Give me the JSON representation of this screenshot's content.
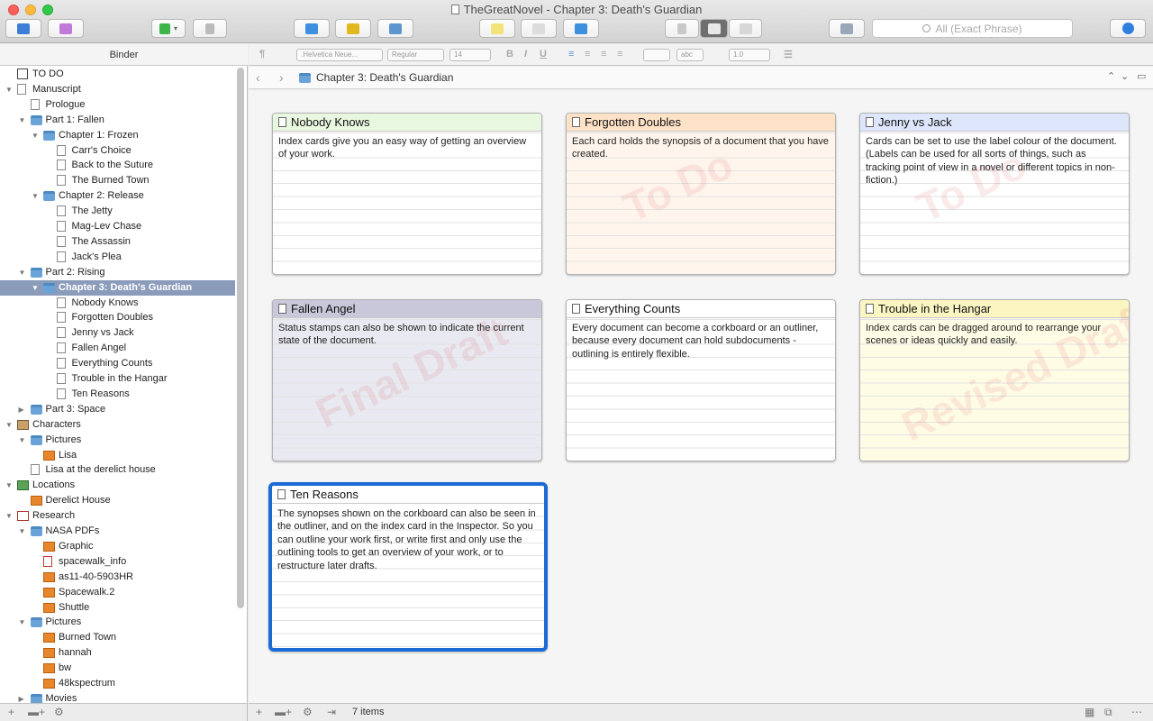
{
  "window": {
    "title": "TheGreatNovel - Chapter 3: Death's Guardian"
  },
  "search": {
    "placeholder": "All (Exact Phrase)"
  },
  "colors": {
    "selection": "#1a6bd6",
    "binder_selection": "#8b9cbb"
  },
  "format_bar": {
    "font": ".Helvetica Neue...",
    "style": "Regular",
    "size": "14",
    "line_spacing": "1.0",
    "paragraph_glyph": "¶",
    "abc": "abc"
  },
  "binder": {
    "header": "Binder",
    "items": [
      {
        "label": "TO DO",
        "icon": "checkbox-icon"
      },
      {
        "label": "Manuscript",
        "icon": "manuscript-icon"
      },
      {
        "label": "Prologue",
        "icon": "document-icon"
      },
      {
        "label": "Part 1: Fallen",
        "icon": "folder-icon"
      },
      {
        "label": "Chapter 1: Frozen",
        "icon": "folder-icon"
      },
      {
        "label": "Carr's Choice",
        "icon": "document-icon"
      },
      {
        "label": "Back to the Suture",
        "icon": "document-icon"
      },
      {
        "label": "The Burned Town",
        "icon": "document-icon"
      },
      {
        "label": "Chapter 2: Release",
        "icon": "folder-icon"
      },
      {
        "label": "The Jetty",
        "icon": "document-icon"
      },
      {
        "label": "Mag-Lev Chase",
        "icon": "document-icon"
      },
      {
        "label": "The Assassin",
        "icon": "document-icon"
      },
      {
        "label": "Jack's Plea",
        "icon": "document-icon"
      },
      {
        "label": "Part 2: Rising",
        "icon": "folder-icon"
      },
      {
        "label": "Chapter 3: Death's Guardian",
        "icon": "folder-icon"
      },
      {
        "label": "Nobody Knows",
        "icon": "document-icon"
      },
      {
        "label": "Forgotten Doubles",
        "icon": "document-icon"
      },
      {
        "label": "Jenny vs Jack",
        "icon": "document-icon"
      },
      {
        "label": "Fallen Angel",
        "icon": "document-icon"
      },
      {
        "label": "Everything Counts",
        "icon": "document-icon"
      },
      {
        "label": "Trouble in the Hangar",
        "icon": "document-icon"
      },
      {
        "label": "Ten Reasons",
        "icon": "document-icon"
      },
      {
        "label": "Part 3: Space",
        "icon": "folder-icon"
      },
      {
        "label": "Characters",
        "icon": "characters-icon"
      },
      {
        "label": "Pictures",
        "icon": "folder-icon"
      },
      {
        "label": "Lisa",
        "icon": "image-icon"
      },
      {
        "label": "Lisa at the derelict house",
        "icon": "document-icon"
      },
      {
        "label": "Locations",
        "icon": "locations-icon"
      },
      {
        "label": "Derelict House",
        "icon": "image-icon"
      },
      {
        "label": "Research",
        "icon": "research-icon"
      },
      {
        "label": "NASA PDFs",
        "icon": "folder-icon"
      },
      {
        "label": "Graphic",
        "icon": "image-icon"
      },
      {
        "label": "spacewalk_info",
        "icon": "pdf-icon"
      },
      {
        "label": "as11-40-5903HR",
        "icon": "image-icon"
      },
      {
        "label": "Spacewalk.2",
        "icon": "image-icon"
      },
      {
        "label": "Shuttle",
        "icon": "image-icon"
      },
      {
        "label": "Pictures",
        "icon": "folder-icon"
      },
      {
        "label": "Burned Town",
        "icon": "image-icon"
      },
      {
        "label": "hannah",
        "icon": "image-icon"
      },
      {
        "label": "bw",
        "icon": "image-icon"
      },
      {
        "label": "48kspectrum",
        "icon": "image-icon"
      },
      {
        "label": "Movies",
        "icon": "folder-icon"
      }
    ]
  },
  "pathbar": {
    "title": "Chapter 3: Death's Guardian"
  },
  "cards": [
    {
      "title": "Nobody Knows",
      "text": "Index cards give you an easy way of getting an overview of your work.",
      "header_color": "#e8f7df",
      "body_color": "#ffffff",
      "stamp": ""
    },
    {
      "title": "Forgotten Doubles",
      "text": "Each card holds the synopsis of a document that you have created.",
      "header_color": "#fde2c8",
      "body_color": "#fff5ec",
      "stamp": "To Do"
    },
    {
      "title": "Jenny vs Jack",
      "text": "Cards can be set to use the label colour of the document. (Labels can be used for all sorts of things, such as tracking point of view in a novel or different topics in non-fiction.)",
      "header_color": "#dde6fb",
      "body_color": "#ffffff",
      "stamp": "To Do"
    },
    {
      "title": "Fallen Angel",
      "text": "Status stamps can also be shown to indicate the current state of the document.",
      "header_color": "#c8c8da",
      "body_color": "#e9e9f1",
      "stamp": "Final Draft"
    },
    {
      "title": "Everything Counts",
      "text": "Every document can become a corkboard or an outliner, because every document can hold subdocuments - outlining is entirely flexible.",
      "header_color": "#ffffff",
      "body_color": "#ffffff",
      "stamp": ""
    },
    {
      "title": "Trouble in the Hangar",
      "text": "Index cards can be dragged around to rearrange your scenes or ideas quickly and easily.",
      "header_color": "#fbf5c2",
      "body_color": "#fffce6",
      "stamp": "Revised Draft"
    },
    {
      "title": "Ten Reasons",
      "text": "The synopses shown on the corkboard can also be seen in the outliner, and on the index card in the Inspector. So you can outline your work first, or write first and only use the outlining tools to get an overview of your work, or to restructure later drafts.",
      "header_color": "#ffffff",
      "body_color": "#ffffff",
      "stamp": ""
    }
  ],
  "footer": {
    "item_count": "7 items"
  }
}
